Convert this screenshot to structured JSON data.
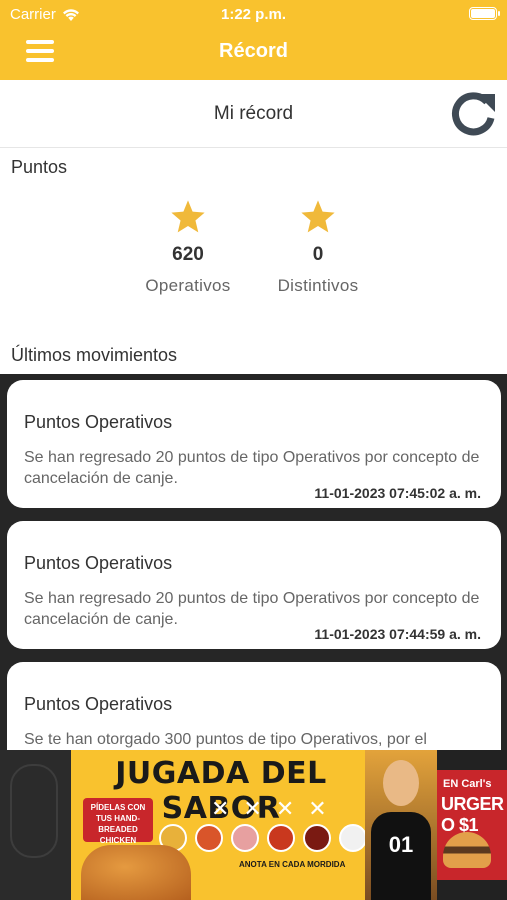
{
  "status_bar": {
    "carrier": "Carrier",
    "time": "1:22 p.m."
  },
  "nav": {
    "title": "Récord"
  },
  "header": {
    "title": "Mi récord"
  },
  "points": {
    "section_label": "Puntos",
    "stats": [
      {
        "value": "620",
        "label": "Operativos"
      },
      {
        "value": "0",
        "label": "Distintivos"
      }
    ]
  },
  "movements": {
    "section_label": "Últimos movimientos",
    "items": [
      {
        "title": "Puntos Operativos",
        "description": "Se han regresado 20 puntos de tipo Operativos por concepto de cancelación de canje.",
        "date": "11-01-2023 07:45:02 a. m."
      },
      {
        "title": "Puntos Operativos",
        "description": "Se han regresado 20 puntos de tipo Operativos por concepto de cancelación de canje.",
        "date": "11-01-2023 07:44:59 a. m."
      },
      {
        "title": "Puntos Operativos",
        "description": "Se te han otorgado 300 puntos de tipo Operativos, por el",
        "date": ""
      }
    ]
  },
  "ad": {
    "headline": "JUGADA DEL SABOR",
    "marks": "✕✕✕✕",
    "badge": "PÍDELAS CON TUS HAND-BREADED CHICKEN TENDERS",
    "tagline": "ANOTA EN CADA MORDIDA",
    "jersey": "01",
    "side_line1": "EN Carl's",
    "side_line2": "URGER O $1",
    "sauce_colors": [
      "#e8b13a",
      "#d9552a",
      "#e7a0a0",
      "#c9381e",
      "#7a1a12",
      "#f1f1f1"
    ]
  },
  "colors": {
    "accent": "#f9c22e",
    "list_background": "#262626"
  }
}
